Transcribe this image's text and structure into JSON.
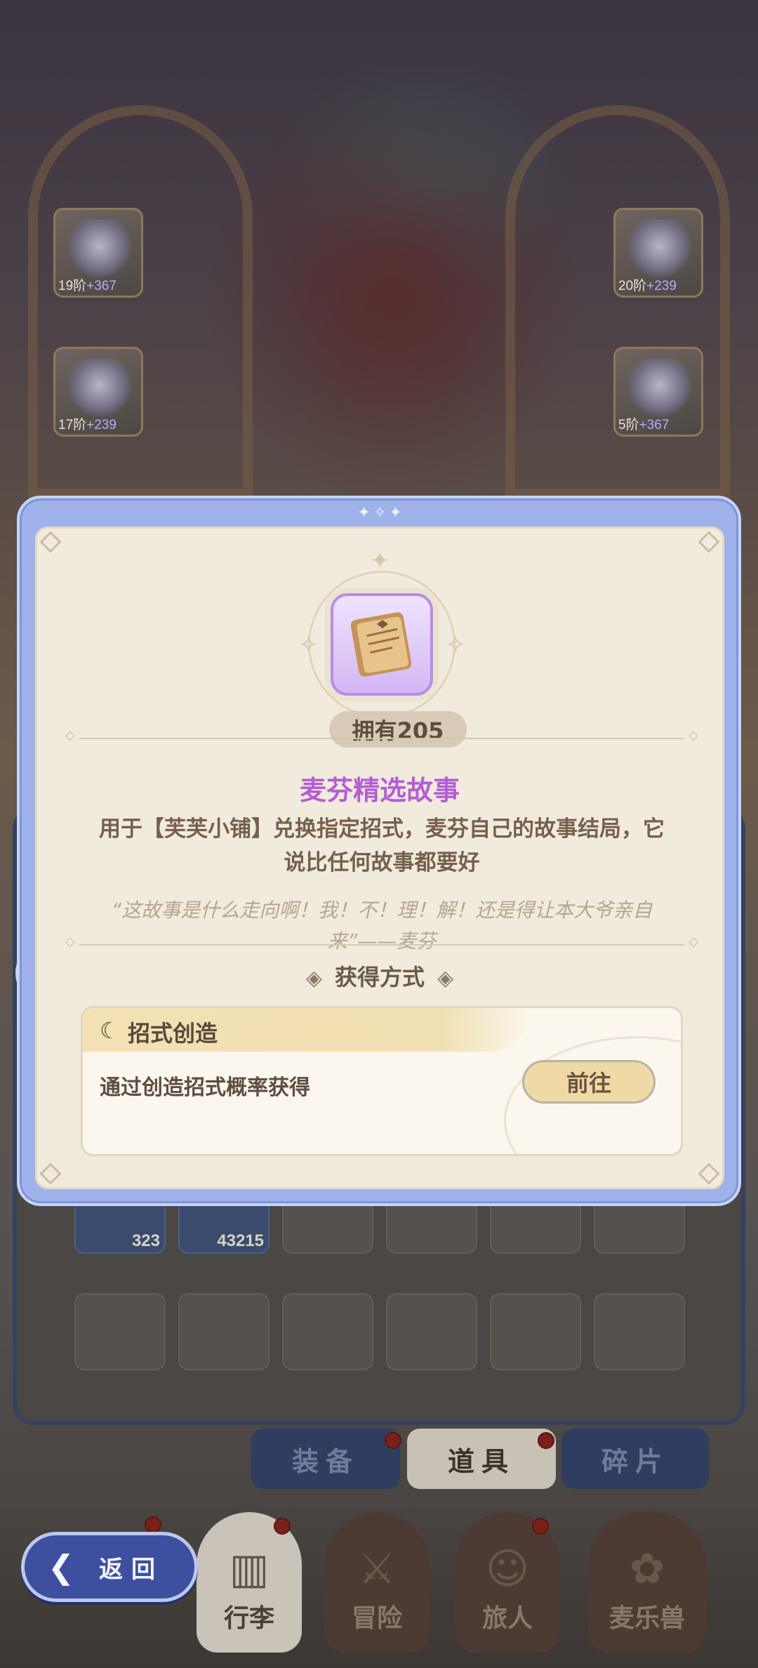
{
  "background": {
    "equipment_slots": [
      {
        "level": "19阶",
        "bonus": "+367"
      },
      {
        "level": "17阶",
        "bonus": "+239"
      },
      {
        "level": "20阶",
        "bonus": "+239"
      },
      {
        "level": "5阶",
        "bonus": "+367"
      }
    ],
    "inventory_counts": [
      "323",
      "43215"
    ],
    "category_tabs": [
      {
        "label": "装备"
      },
      {
        "label": "道具"
      },
      {
        "label": "碎片"
      }
    ],
    "bottom_nav": [
      {
        "label": "行李"
      },
      {
        "label": "冒险"
      },
      {
        "label": "旅人"
      },
      {
        "label": "麦乐兽"
      }
    ],
    "back_label": "返回"
  },
  "modal": {
    "owned": "拥有205",
    "item_name": "麦芬精选故事",
    "description": "用于【芙芙小铺】兑换指定招式，麦芬自己的故事结局，它说比任何故事都要好",
    "quote": "“这故事是什么走向啊！我！不！理！解！还是得让本大爷亲自来”——麦芬",
    "obtain_title": "获得方式",
    "source": {
      "title": "招式创造",
      "description": "通过创造招式概率获得",
      "button": "前往"
    }
  },
  "colors": {
    "item_name": "#b45ed3",
    "modal_border": "#9fb3ea",
    "panel_bg": "#f1ebdd",
    "button_bg": "#efd9a4"
  }
}
